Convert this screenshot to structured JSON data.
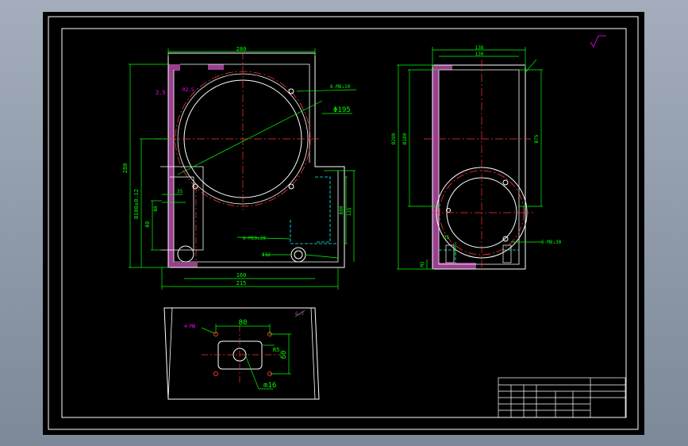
{
  "colors": {
    "background": "#8a95a5",
    "sheet": "#000000",
    "outline": "#ffffff",
    "dimension": "#00ff00",
    "annotation": "#ff00ff",
    "centerline": "#ff3333",
    "hidden": "#00ffff",
    "section_fill": "#9a3f8f"
  },
  "front_view": {
    "dim_top_width": "280",
    "dim_height": "280",
    "dim_center": "B100±0.12",
    "dim_bore": "Φ195",
    "dim_bolt": "6-M8↓10",
    "dim_left_small": "2.5",
    "dim_lower": "40",
    "dim_bottom_inner": "160",
    "dim_bottom_total": "215",
    "dim_tap": "6-M10↓20",
    "dim_hole": "Φ32",
    "dim_right": "12Q",
    "dim_right_inner": "B80",
    "dim_left_b": "B8",
    "dim_left_35": "35",
    "dim_r3": "R2.5"
  },
  "side_view": {
    "dim_top_total": "138",
    "dim_top_inner": "130",
    "dim_height": "B200",
    "dim_height_inner": "B180",
    "dim_right": "B75",
    "dim_tap": "6-M8↓30",
    "dim_small": "25",
    "dim_bottom": "M3"
  },
  "top_view": {
    "dim_80": "80",
    "dim_60": "60",
    "dim_m16": "m16",
    "label_holes": "4-M8",
    "dim_r": "R5"
  },
  "title_block": {
    "row1": "",
    "row2": "",
    "row3": ""
  },
  "roughness_mark": "6.3"
}
